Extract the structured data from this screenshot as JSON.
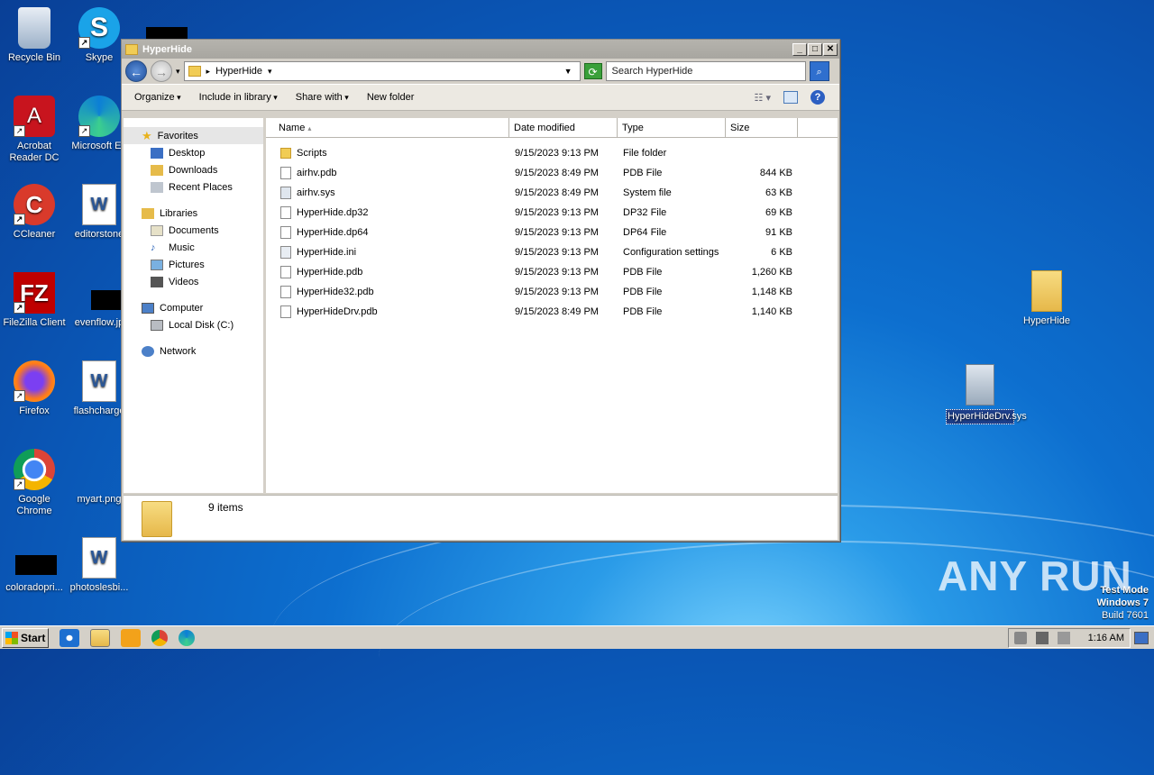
{
  "desktop": {
    "icons": [
      {
        "label": "Recycle Bin"
      },
      {
        "label": "Skype"
      },
      {
        "label": "Acrobat Reader DC"
      },
      {
        "label": "Microsoft Ed"
      },
      {
        "label": "CCleaner"
      },
      {
        "label": "editorstone"
      },
      {
        "label": "FileZilla Client"
      },
      {
        "label": "evenflow.jp"
      },
      {
        "label": "Firefox"
      },
      {
        "label": "flashcharge"
      },
      {
        "label": "Google Chrome"
      },
      {
        "label": "myart.png"
      },
      {
        "label": "coloradopri..."
      },
      {
        "label": "photoslesbi..."
      },
      {
        "label": "HyperHide"
      },
      {
        "label": "HyperHideDrv.sys"
      }
    ]
  },
  "window": {
    "title": "HyperHide",
    "address": "HyperHide",
    "search_placeholder": "Search HyperHide",
    "toolbar": {
      "organize": "Organize",
      "include": "Include in library",
      "share": "Share with",
      "newfolder": "New folder"
    },
    "nav": {
      "favorites": "Favorites",
      "desktop": "Desktop",
      "downloads": "Downloads",
      "recent": "Recent Places",
      "libraries": "Libraries",
      "documents": "Documents",
      "music": "Music",
      "pictures": "Pictures",
      "videos": "Videos",
      "computer": "Computer",
      "localdisk": "Local Disk (C:)",
      "network": "Network"
    },
    "columns": {
      "name": "Name",
      "date": "Date modified",
      "type": "Type",
      "size": "Size"
    },
    "files": [
      {
        "name": "Scripts",
        "date": "9/15/2023 9:13 PM",
        "type": "File folder",
        "size": ""
      },
      {
        "name": "airhv.pdb",
        "date": "9/15/2023 8:49 PM",
        "type": "PDB File",
        "size": "844 KB"
      },
      {
        "name": "airhv.sys",
        "date": "9/15/2023 8:49 PM",
        "type": "System file",
        "size": "63 KB"
      },
      {
        "name": "HyperHide.dp32",
        "date": "9/15/2023 9:13 PM",
        "type": "DP32 File",
        "size": "69 KB"
      },
      {
        "name": "HyperHide.dp64",
        "date": "9/15/2023 9:13 PM",
        "type": "DP64 File",
        "size": "91 KB"
      },
      {
        "name": "HyperHide.ini",
        "date": "9/15/2023 9:13 PM",
        "type": "Configuration settings",
        "size": "6 KB"
      },
      {
        "name": "HyperHide.pdb",
        "date": "9/15/2023 9:13 PM",
        "type": "PDB File",
        "size": "1,260 KB"
      },
      {
        "name": "HyperHide32.pdb",
        "date": "9/15/2023 9:13 PM",
        "type": "PDB File",
        "size": "1,148 KB"
      },
      {
        "name": "HyperHideDrv.pdb",
        "date": "9/15/2023 8:49 PM",
        "type": "PDB File",
        "size": "1,140 KB"
      }
    ],
    "status": "9 items"
  },
  "taskbar": {
    "start": "Start",
    "time": "1:16 AM"
  },
  "watermark": "ANY RUN",
  "testmode": {
    "line1": "Test Mode",
    "line2": "Windows 7",
    "line3": "Build 7601"
  }
}
